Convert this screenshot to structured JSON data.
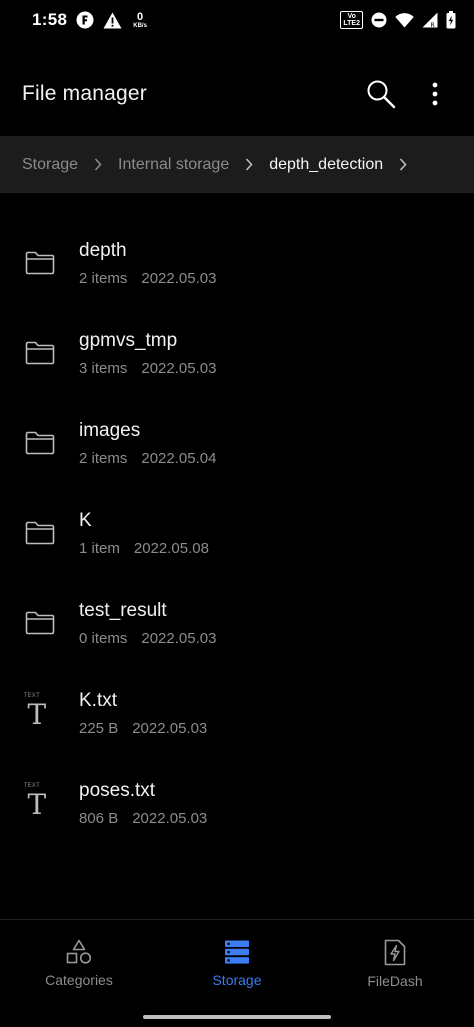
{
  "status_bar": {
    "time": "1:58",
    "speed_value": "0",
    "speed_unit": "KB/s",
    "lte_line1": "Vo",
    "lte_line2": "LTE2"
  },
  "app_bar": {
    "title": "File manager",
    "search_icon": "search-icon",
    "menu_icon": "more-vert-icon"
  },
  "breadcrumb": {
    "items": [
      "Storage",
      "Internal storage",
      "depth_detection"
    ]
  },
  "files": [
    {
      "name": "depth",
      "info": "2 items",
      "date": "2022.05.03",
      "icon": "folder-icon"
    },
    {
      "name": "gpmvs_tmp",
      "info": "3 items",
      "date": "2022.05.03",
      "icon": "folder-icon"
    },
    {
      "name": "images",
      "info": "2 items",
      "date": "2022.05.04",
      "icon": "folder-icon"
    },
    {
      "name": "K",
      "info": "1 item",
      "date": "2022.05.08",
      "icon": "folder-icon"
    },
    {
      "name": "test_result",
      "info": "0 items",
      "date": "2022.05.03",
      "icon": "folder-icon"
    },
    {
      "name": "K.txt",
      "info": "225 B",
      "date": "2022.05.03",
      "icon": "text-file-icon",
      "tag": "TEXT"
    },
    {
      "name": "poses.txt",
      "info": "806 B",
      "date": "2022.05.03",
      "icon": "text-file-icon",
      "tag": "TEXT"
    }
  ],
  "bottom_nav": {
    "items": [
      {
        "label": "Categories",
        "icon": "categories-icon",
        "active": false
      },
      {
        "label": "Storage",
        "icon": "storage-icon",
        "active": true
      },
      {
        "label": "FileDash",
        "icon": "filedash-icon",
        "active": false
      }
    ]
  },
  "colors": {
    "accent": "#3d7cf1",
    "background": "#000000",
    "breadcrumb_bg": "#1c1c1c"
  }
}
